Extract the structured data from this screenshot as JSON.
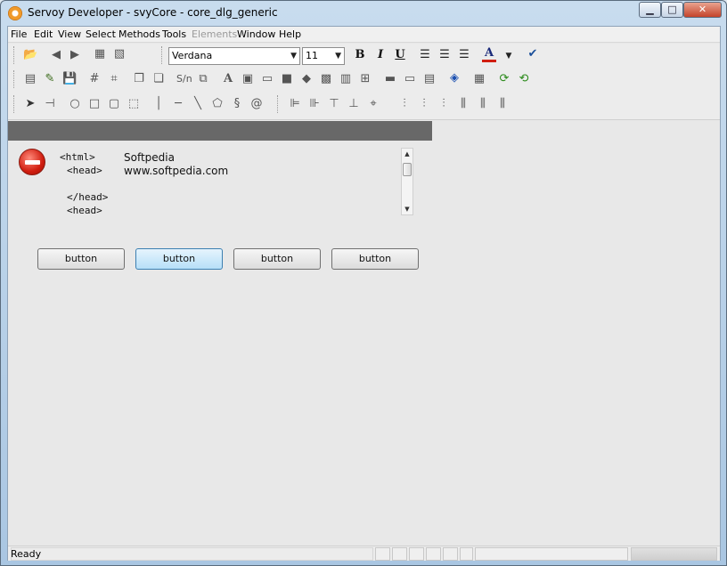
{
  "window": {
    "title": "Servoy Developer - svyCore - core_dlg_generic",
    "minimize_glyph": "▁",
    "maximize_glyph": "□",
    "close_glyph": "✕"
  },
  "menu": {
    "file": "File",
    "edit": "Edit",
    "view": "View",
    "select": "Select",
    "methods": "Methods",
    "tools": "Tools",
    "elements": "Elements",
    "window": "Window",
    "help": "Help"
  },
  "toolbar": {
    "font_name": "Verdana",
    "font_size": "11",
    "bold": "B",
    "italic": "I",
    "underline": "U",
    "font_color": "A",
    "icons": [
      "open-folder-icon",
      "back-arrow-icon",
      "forward-arrow-icon",
      "add-field-icon",
      "remove-field-icon"
    ]
  },
  "form": {
    "html_lines": [
      "<html>",
      "<head>",
      "</head>",
      "<head>"
    ],
    "html_text": [
      "Softpedia",
      "www.softpedia.com"
    ],
    "buttons": [
      "button",
      "button",
      "button",
      "button"
    ]
  },
  "status": {
    "text": "Ready"
  },
  "colors": {
    "accent": "#3c7fb1",
    "header_bar": "#686868",
    "error_red": "#d11e10"
  }
}
